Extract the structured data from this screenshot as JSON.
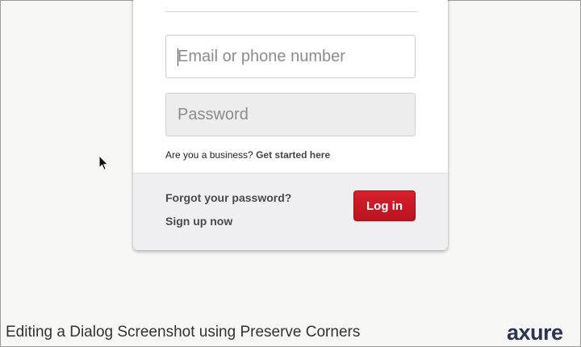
{
  "form": {
    "email_placeholder": "Email or phone number",
    "password_placeholder": "Password",
    "business_prompt": "Are you a business?",
    "business_link": "Get started here"
  },
  "footer": {
    "forgot_password": "Forgot your password?",
    "sign_up": "Sign up now",
    "login_button": "Log in"
  },
  "caption": "Editing a Dialog Screenshot using Preserve Corners",
  "brand_logo": "axure",
  "colors": {
    "login_button": "#c8161f",
    "footer_bg": "#efeff1",
    "logo": "#2a3550"
  },
  "icons": {
    "cursor": "mouse-pointer-icon"
  }
}
